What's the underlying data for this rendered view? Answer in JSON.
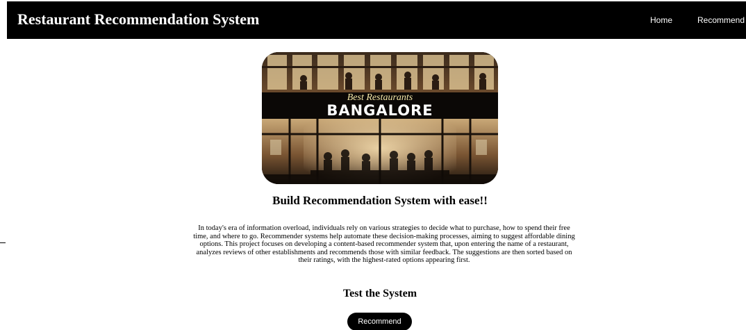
{
  "navbar": {
    "brand": "Restaurant Recommendation System",
    "links": [
      "Home",
      "Recommend"
    ]
  },
  "hero": {
    "script_text": "Best Restaurants",
    "title_text": "BANGALORE"
  },
  "main": {
    "subheading": "Build Recommendation System with ease!!",
    "description": "In today's era of information overload, individuals rely on various strategies to decide what to purchase, how to spend their free time, and where to go. Recommender systems help automate these decision-making processes, aiming to suggest affordable dining options. This project focuses on developing a content-based recommender system that, upon entering the name of a restaurant, analyzes reviews of other establishments and recommends those with similar feedback. The suggestions are then sorted based on their ratings, with the highest-rated options appearing first.",
    "test_heading": "Test the System",
    "button_label": "Recommend"
  },
  "colors": {
    "navbar_bg": "#000000",
    "navbar_text": "#ffffff",
    "button_bg": "#000000",
    "button_text": "#ffffff",
    "hero_script": "#f3e7a8"
  }
}
